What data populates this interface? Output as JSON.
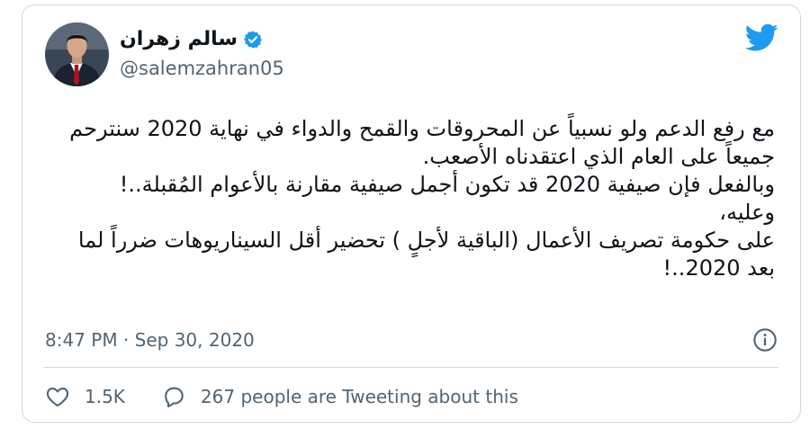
{
  "author": {
    "display_name": "سالم زهران",
    "handle": "@salemzahran05",
    "verified": true
  },
  "tweet": {
    "lines": [
      "مع رفع الدعم ولو نسبياً عن المحروقات والقمح والدواء في نهاية 2020 سنترحم",
      "جميعاً على العام الذي اعتقدناه الأصعب.",
      "وبالفعل فإن صيفية 2020 قد تكون أجمل صيفية مقارنة بالأعوام المُقبلة..!",
      "وعليه،",
      "على حكومة تصريف الأعمال (الباقية لأجلٍ ) تحضير أقل السيناريوهات ضرراً لما",
      "بعد 2020..!"
    ]
  },
  "meta": {
    "timestamp": "8:47 PM · Sep 30, 2020"
  },
  "engagement": {
    "likes": "1.5K",
    "tweeting_text": "267 people are Tweeting about this"
  },
  "colors": {
    "brand_blue": "#1d9bf0",
    "text_primary": "#0f1419",
    "text_secondary": "#536471",
    "border": "#cfd9de"
  },
  "icons": [
    "twitter-bird-icon",
    "verified-badge-icon",
    "info-icon",
    "heart-icon",
    "speech-bubble-icon"
  ]
}
